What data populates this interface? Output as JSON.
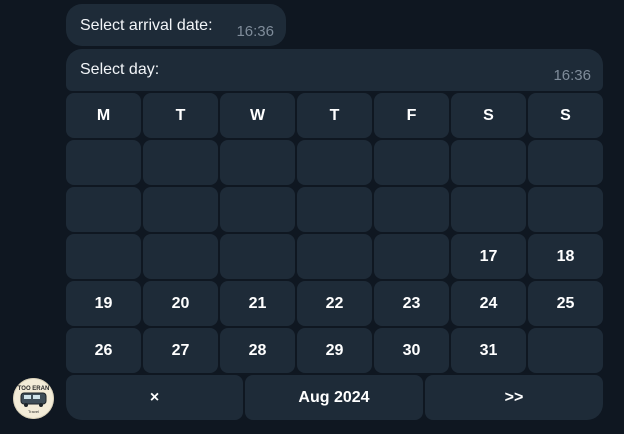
{
  "messages": [
    {
      "text": "Select arrival date:",
      "time": "16:36"
    },
    {
      "text": "Select day:",
      "time": "16:36"
    }
  ],
  "calendar": {
    "weekdays": [
      "M",
      "T",
      "W",
      "T",
      "F",
      "S",
      "S"
    ],
    "weeks": [
      [
        "",
        "",
        "",
        "",
        "",
        "",
        ""
      ],
      [
        "",
        "",
        "",
        "",
        "",
        "",
        ""
      ],
      [
        "",
        "",
        "",
        "",
        "",
        "17",
        "18"
      ],
      [
        "19",
        "20",
        "21",
        "22",
        "23",
        "24",
        "25"
      ],
      [
        "26",
        "27",
        "28",
        "29",
        "30",
        "31",
        ""
      ]
    ],
    "nav": {
      "close": "×",
      "month": "Aug 2024",
      "next": ">>"
    }
  },
  "avatar": {
    "logo_text": "TOO ERAN",
    "logo_subtext": "Travel"
  },
  "colors": {
    "background": "#0f1721",
    "bubble": "#1e2b38",
    "time": "#7f8c9a"
  }
}
